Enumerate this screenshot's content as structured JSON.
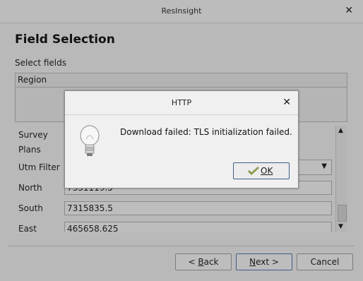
{
  "window": {
    "title": "ResInsight"
  },
  "wizard": {
    "heading": "Field Selection",
    "select_fields_label": "Select fields",
    "fields": [
      {
        "label": "Region"
      }
    ],
    "panel": {
      "survey_label": "Survey",
      "plans_label": "Plans",
      "utm_filter_label": "Utm Filter",
      "north_label": "North",
      "north_value": "7331119.5",
      "south_label": "South",
      "south_value": "7315835.5",
      "east_label": "East",
      "east_value": "465658.625"
    },
    "buttons": {
      "back_prefix": "< ",
      "back_mnemonic": "B",
      "back_rest": "ack",
      "next_mnemonic": "N",
      "next_rest": "ext >",
      "cancel": "Cancel"
    }
  },
  "dialog": {
    "title": "HTTP",
    "message": "Download failed: TLS initialization failed.",
    "ok_mnemonic": "O",
    "ok_rest": "K",
    "icon": "lightbulb-icon"
  },
  "colors": {
    "background": "#b9b9b9",
    "dialog_bg": "#f0f0f0",
    "accent_border": "#3e5e86"
  }
}
